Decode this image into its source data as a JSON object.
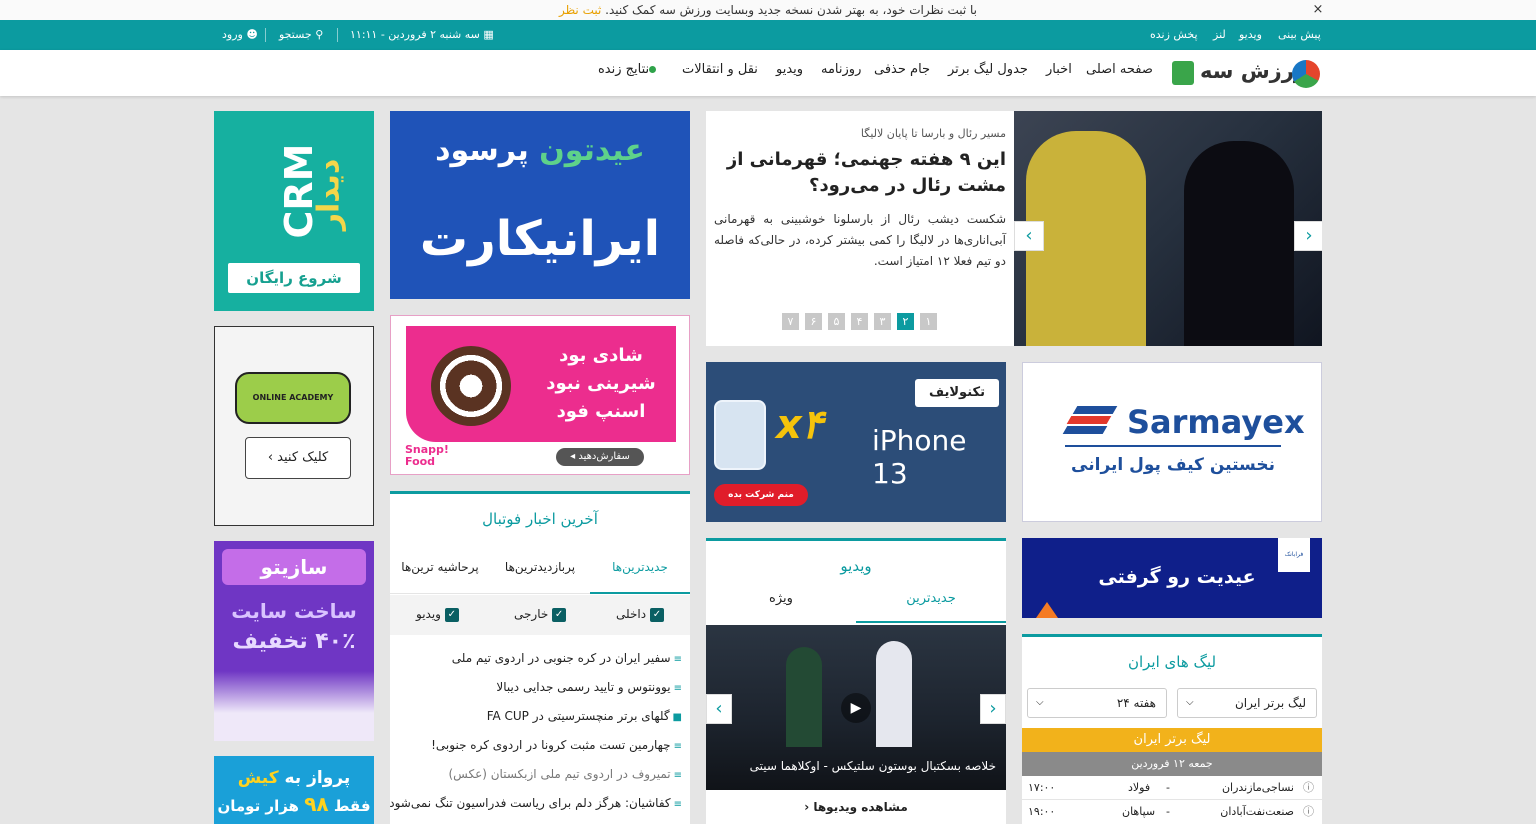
{
  "notice": {
    "text": "با ثبت نظرات خود، به بهتر شدن نسخه جدید وبسایت ورزش سه کمک کنید.",
    "link": "ثبت نظر",
    "close": "×"
  },
  "topbar": {
    "links": [
      "پیش بینی",
      "ویدیو",
      "لنز",
      "پخش زنده"
    ],
    "date": "سه شنبه ۲ فروردین - ۱۱:۱۱",
    "search": "جستجو",
    "login": "ورود"
  },
  "nav": {
    "logo": "ورزش سه",
    "items": [
      "صفحه اصلی",
      "اخبار",
      "جدول لیگ برتر",
      "جام حذفی",
      "روزنامه",
      "ویدیو",
      "نقل و انتقالات",
      "نتایج زنده"
    ]
  },
  "hero": {
    "kicker": "مسیر رئال و بارسا تا پایان لالیگا",
    "title": "این ۹ هفته جهنمی؛ قهرمانی از مشت رئال در می‌رود؟",
    "summary": "شکست دیشب رئال از بارسلونا خوشبینی به قهرمانی آبی‌اناری‌ها در لالیگا را کمی بیشتر کرده، در حالی‌که فاصله دو تیم فعلا ۱۲ امتیاز است.",
    "pages": [
      "۷",
      "۶",
      "۵",
      "۴",
      "۳",
      "۲",
      "۱"
    ],
    "active_page": "۲"
  },
  "ads": {
    "crm_title": "CRM",
    "crm_brand": "دیدار",
    "crm_cta": "شروع رایگان",
    "irankart_top_a": "عیدتون",
    "irankart_top_b": "پرسود",
    "irankart_main": "ایرانیکارت",
    "snapp_l1": "شادی بود",
    "snapp_l2": "شیرینی نبود",
    "snapp_l3": "اسنپ فود",
    "snapp_brand": "Snapp! Food",
    "snapp_cta": "سفارش‌دهید ◂",
    "academy_cta": "کلیک کنید ›",
    "academy_brand": "ONLINE ACADEMY",
    "sazito_brand": "سازیتو",
    "sazito_l1": "ساخت سایت",
    "sazito_l2": "۴۰٪ تخفیف",
    "kish_l1a": "پرواز به",
    "kish_l1b": "کیش",
    "kish_l2a": "فقط",
    "kish_l2b": "۹۸",
    "kish_l2c": "هزار تومان",
    "techno_brand": "تکنولایف",
    "techno_phone": "iPhone 13",
    "techno_x": "x۴",
    "techno_cta": "منم شرکت بده",
    "sarmayex_brand": "Sarmayex",
    "sarmayex_sub": "نخستین کیف پول ایرانی",
    "eid_text": "عیدیت رو گرفتی",
    "eid_logo": "فرابانک"
  },
  "news": {
    "title": "آخرین اخبار فوتبال",
    "tabs": [
      "جدیدترین‌ها",
      "پربازدیدترین‌ها",
      "پرحاشیه ترین‌ها"
    ],
    "filters": [
      "داخلی",
      "خارجی",
      "ویدیو"
    ],
    "items": [
      "سفیر ایران در کره جنوبی در اردوی تیم ملی",
      "یوونتوس و تایید رسمی جدایی دیبالا",
      "گلهای برتر منچسترسیتی در FA CUP",
      "چهارمین تست مثبت کرونا در اردوی کره جنوبی!",
      "تمیروف در اردوی تیم ملی ازبکستان (عکس)",
      "کفاشیان: هرگز دلم برای ریاست فدراسیون تنگ نمی‌شود"
    ]
  },
  "video": {
    "title": "ویدیو",
    "tabs": [
      "جدیدترین",
      "ویژه"
    ],
    "caption": "خلاصه بسکتبال بوستون سلتیکس - اوکلاهما سیتی",
    "more": "مشاهده ویدیوها"
  },
  "league": {
    "title": "لیگ های ایران",
    "select_league": "لیگ برتر ایران",
    "select_week": "هفته ۲۴",
    "band": "لیگ برتر ایران",
    "date": "جمعه ۱۲ فروردین",
    "matches": [
      {
        "home": "نساجی‌مازندران",
        "away": "فولاد",
        "time": "۱۷:۰۰"
      },
      {
        "home": "صنعت‌نفت‌آبادان",
        "away": "سپاهان",
        "time": "۱۹:۰۰"
      }
    ]
  },
  "colors": {
    "teal": "#0c9ba0",
    "notice_link": "#e8a000",
    "league_band": "#f2b21b"
  }
}
